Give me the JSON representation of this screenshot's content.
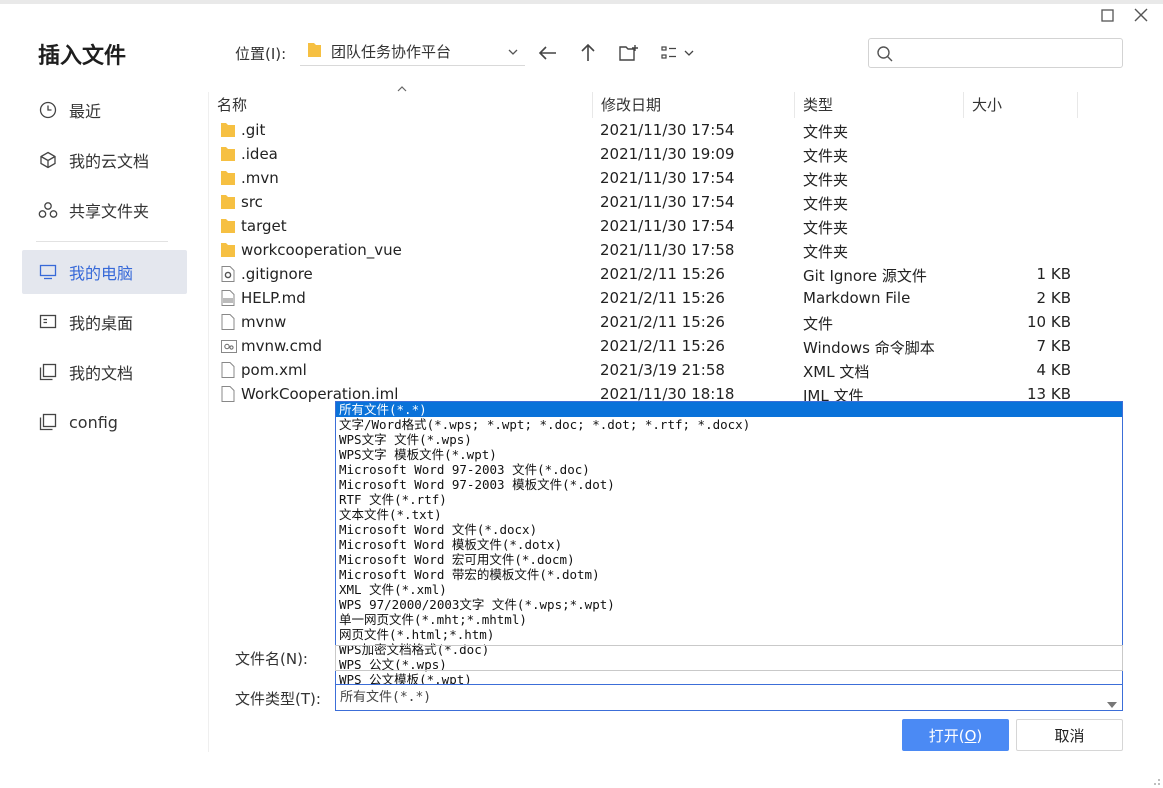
{
  "dialog": {
    "title": "插入文件"
  },
  "sidebar": {
    "items": [
      {
        "label": "最近",
        "icon": "clock-icon"
      },
      {
        "label": "我的云文档",
        "icon": "cloud-doc-icon"
      },
      {
        "label": "共享文件夹",
        "icon": "shared-folder-icon"
      },
      {
        "label": "我的电脑",
        "icon": "computer-icon",
        "active": true
      },
      {
        "label": "我的桌面",
        "icon": "desktop-icon"
      },
      {
        "label": "我的文档",
        "icon": "documents-icon"
      },
      {
        "label": "config",
        "icon": "folder-icon"
      }
    ]
  },
  "toolbar": {
    "location_label": "位置(I):",
    "location_value": "团队任务协作平台",
    "search_placeholder": ""
  },
  "columns": {
    "name": "名称",
    "modified": "修改日期",
    "type": "类型",
    "size": "大小"
  },
  "files": [
    {
      "name": ".git",
      "date": "2021/11/30 17:54",
      "type": "文件夹",
      "size": "",
      "icon": "folder-icon"
    },
    {
      "name": ".idea",
      "date": "2021/11/30 19:09",
      "type": "文件夹",
      "size": "",
      "icon": "folder-icon"
    },
    {
      "name": ".mvn",
      "date": "2021/11/30 17:54",
      "type": "文件夹",
      "size": "",
      "icon": "folder-icon"
    },
    {
      "name": "src",
      "date": "2021/11/30 17:54",
      "type": "文件夹",
      "size": "",
      "icon": "folder-icon"
    },
    {
      "name": "target",
      "date": "2021/11/30 17:54",
      "type": "文件夹",
      "size": "",
      "icon": "folder-icon"
    },
    {
      "name": "workcooperation_vue",
      "date": "2021/11/30 17:58",
      "type": "文件夹",
      "size": "",
      "icon": "folder-icon"
    },
    {
      "name": ".gitignore",
      "date": "2021/2/11 15:26",
      "type": "Git Ignore 源文件",
      "size": "1 KB",
      "icon": "gear-file-icon"
    },
    {
      "name": "HELP.md",
      "date": "2021/2/11 15:26",
      "type": "Markdown File",
      "size": "2 KB",
      "icon": "markdown-file-icon"
    },
    {
      "name": "mvnw",
      "date": "2021/2/11 15:26",
      "type": "文件",
      "size": "10 KB",
      "icon": "file-icon"
    },
    {
      "name": "mvnw.cmd",
      "date": "2021/2/11 15:26",
      "type": "Windows 命令脚本",
      "size": "7 KB",
      "icon": "script-file-icon"
    },
    {
      "name": "pom.xml",
      "date": "2021/3/19 21:58",
      "type": "XML 文档",
      "size": "4 KB",
      "icon": "file-icon"
    },
    {
      "name": "WorkCooperation.iml",
      "date": "2021/11/30 18:18",
      "type": "IML 文件",
      "size": "13 KB",
      "icon": "file-icon"
    }
  ],
  "filename": {
    "label": "文件名(N):",
    "value": ""
  },
  "filetype": {
    "label": "文件类型(T):",
    "selected": "所有文件(*.*)",
    "options": [
      "所有文件(*.*)",
      "文字/Word格式(*.wps; *.wpt; *.doc; *.dot; *.rtf; *.docx)",
      "WPS文字 文件(*.wps)",
      "WPS文字 模板文件(*.wpt)",
      "Microsoft Word 97-2003 文件(*.doc)",
      "Microsoft Word 97-2003 模板文件(*.dot)",
      "RTF 文件(*.rtf)",
      "文本文件(*.txt)",
      "Microsoft Word 文件(*.docx)",
      "Microsoft Word 模板文件(*.dotx)",
      "Microsoft Word 宏可用文件(*.docm)",
      "Microsoft Word 带宏的模板文件(*.dotm)",
      "XML 文件(*.xml)",
      "WPS 97/2000/2003文字 文件(*.wps;*.wpt)",
      "单一网页文件(*.mht;*.mhtml)",
      "网页文件(*.html;*.htm)",
      "WPS加密文档格式(*.doc)",
      "WPS 公文(*.wps)",
      "WPS 公文模板(*.wpt)"
    ]
  },
  "buttons": {
    "open_prefix": "打开(",
    "open_key": "O",
    "open_suffix": ")",
    "cancel": "取消"
  },
  "colors": {
    "accent": "#4b8af4",
    "selected_option": "#0a72d9",
    "folder": "#f6c042",
    "sidebar_active_bg": "#e4e7ee",
    "sidebar_active_text": "#3769d8"
  }
}
